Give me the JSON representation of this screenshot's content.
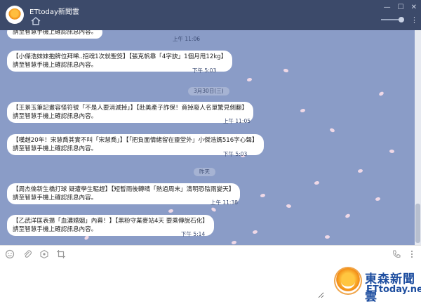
{
  "window": {
    "title": "ETtoday新聞雲",
    "controls": [
      "—",
      "☐",
      "✕"
    ]
  },
  "messages": [
    {
      "title": "",
      "body": "請至智慧手機上確認訊息內容。",
      "time": "上午 11:06"
    },
    {
      "title": "【小傑浩妹妹抱牌位拜唏..招魂1次就聖筊】【張克帆靠「4字訣」1個月甩12kg】",
      "body": "請至智慧手機上確認訊息內容。",
      "time": "下午 5:03"
    },
    {
      "title": "【王景玉筆記畫容怪符號「不是人要消滅掉」】【赴美產子詐保！竟掉廢人名單驚見側翻】",
      "body": "請至智慧手機上確認訊息內容。",
      "time": "上午 11:05"
    },
    {
      "title": "【嘆趙20年！宋慧喬其實不叫「宋慧喬」】【「把負面情緒留在靈堂外」小傑浩媽516字心聲】",
      "body": "請至智慧手機上確認訊息內容。",
      "time": "下午 5:03"
    },
    {
      "title": "【周杰倫新生橋打球 疑遭學生驅趕】【短暫雨後轉晴「熱過周末」清明恐陰雨變天】",
      "body": "請至智慧手機上確認訊息內容。",
      "time": "上午 11:38"
    },
    {
      "title": "【乙武洋匡表揚「血濃婚姻」內幕！】【黑粉守業麥站4天 要乘傳說石化】",
      "body": "請至智慧手機上確認訊息內容。",
      "time": "下午 5:14"
    }
  ],
  "dates": [
    "3月30日(三)",
    "昨天"
  ],
  "input": {
    "placeholder": ""
  },
  "watermark": {
    "cn": "東森新聞雲",
    "en": "ETtoday.net"
  },
  "colors": {
    "chat_bg": "#8a9cc7",
    "titlebar": "#3c4a6a",
    "brand": "#1f4fa0"
  }
}
